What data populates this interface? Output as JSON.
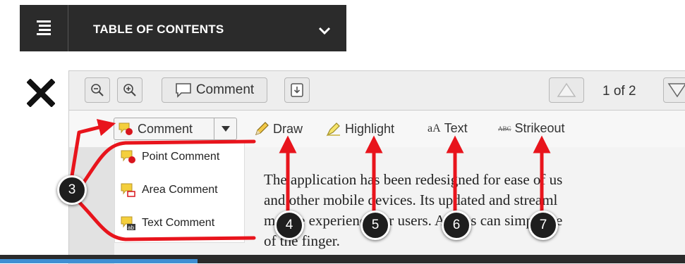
{
  "toc": {
    "title": "TABLE OF CONTENTS"
  },
  "toolbar": {
    "comment_label": "Comment",
    "page_indicator": "1 of 2"
  },
  "annotation_tools": {
    "comment": "Comment",
    "draw": "Draw",
    "highlight": "Highlight",
    "text": "Text",
    "text_glyph": "aA",
    "strikeout": "Strikeout",
    "strikeout_glyph": "ABC"
  },
  "comment_menu": [
    {
      "label": "Point Comment",
      "icon": "point-comment-icon"
    },
    {
      "label": "Area Comment",
      "icon": "area-comment-icon"
    },
    {
      "label": "Text Comment",
      "icon": "text-comment-icon"
    }
  ],
  "document": {
    "lines": [
      "The application has been redesigned for ease of us",
      "and other mobile devices. Its updated and streaml",
      "mobile experience for users. Access can simply be",
      "of the finger."
    ]
  },
  "callouts": [
    "3",
    "4",
    "5",
    "6",
    "7"
  ],
  "colors": {
    "accent": "#e8141c",
    "toc_bar": "#2b2b2b",
    "badge": "#1e1e1e",
    "bottom_accent": "#3f8fd3"
  }
}
